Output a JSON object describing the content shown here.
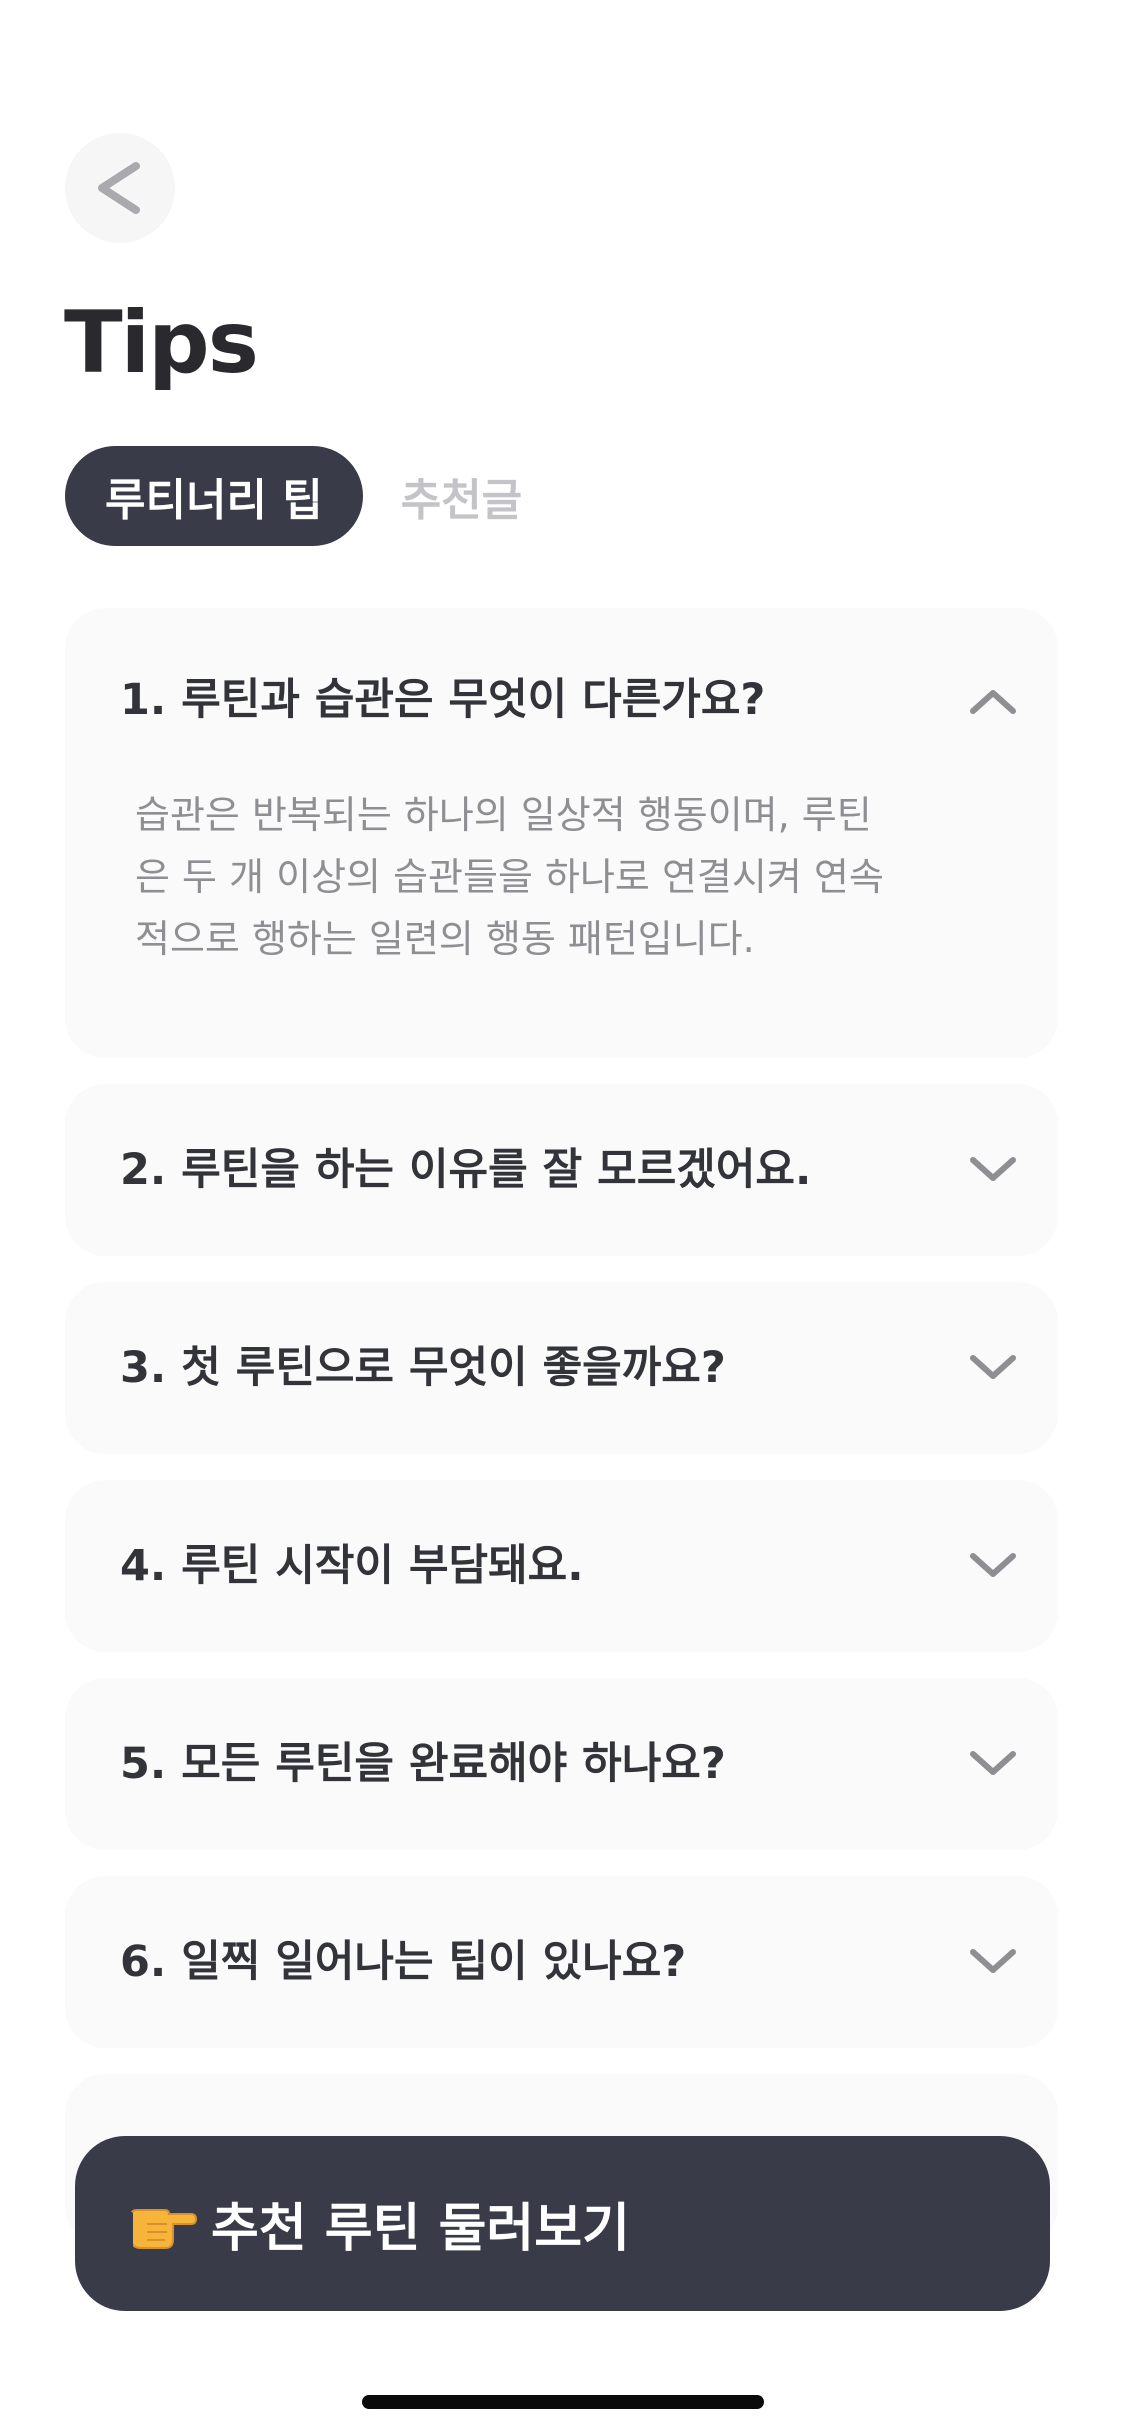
{
  "header": {
    "back_icon": "chevron-left-icon",
    "title": "Tips"
  },
  "tabs": [
    {
      "label": "루티너리 팁",
      "active": true
    },
    {
      "label": "추천글",
      "active": false
    }
  ],
  "faq": [
    {
      "question": "1. 루틴과 습관은 무엇이 다른가요?",
      "expanded": true,
      "answer_lines": [
        "습관은 반복되는 하나의 일상적 행동이며, 루틴",
        "은 두 개 이상의 습관들을 하나로 연결시켜 연속",
        "적으로 행하는 일련의 행동 패턴입니다."
      ]
    },
    {
      "question": "2. 루틴을 하는 이유를 잘 모르겠어요.",
      "expanded": false
    },
    {
      "question": "3. 첫 루틴으로 무엇이 좋을까요?",
      "expanded": false
    },
    {
      "question": "4. 루틴 시작이 부담돼요.",
      "expanded": false
    },
    {
      "question": "5. 모든 루틴을 완료해야 하나요?",
      "expanded": false
    },
    {
      "question": "6. 일찍 일어나는 팁이 있나요?",
      "expanded": false
    }
  ],
  "cta": {
    "icon": "pointing-hand-icon",
    "label": "추천 루틴 둘러보기"
  },
  "colors": {
    "dark": "#3a3b48",
    "card_bg": "#fafafa",
    "inactive_tab": "#c4c4c8",
    "answer_text": "#8e8e93"
  }
}
